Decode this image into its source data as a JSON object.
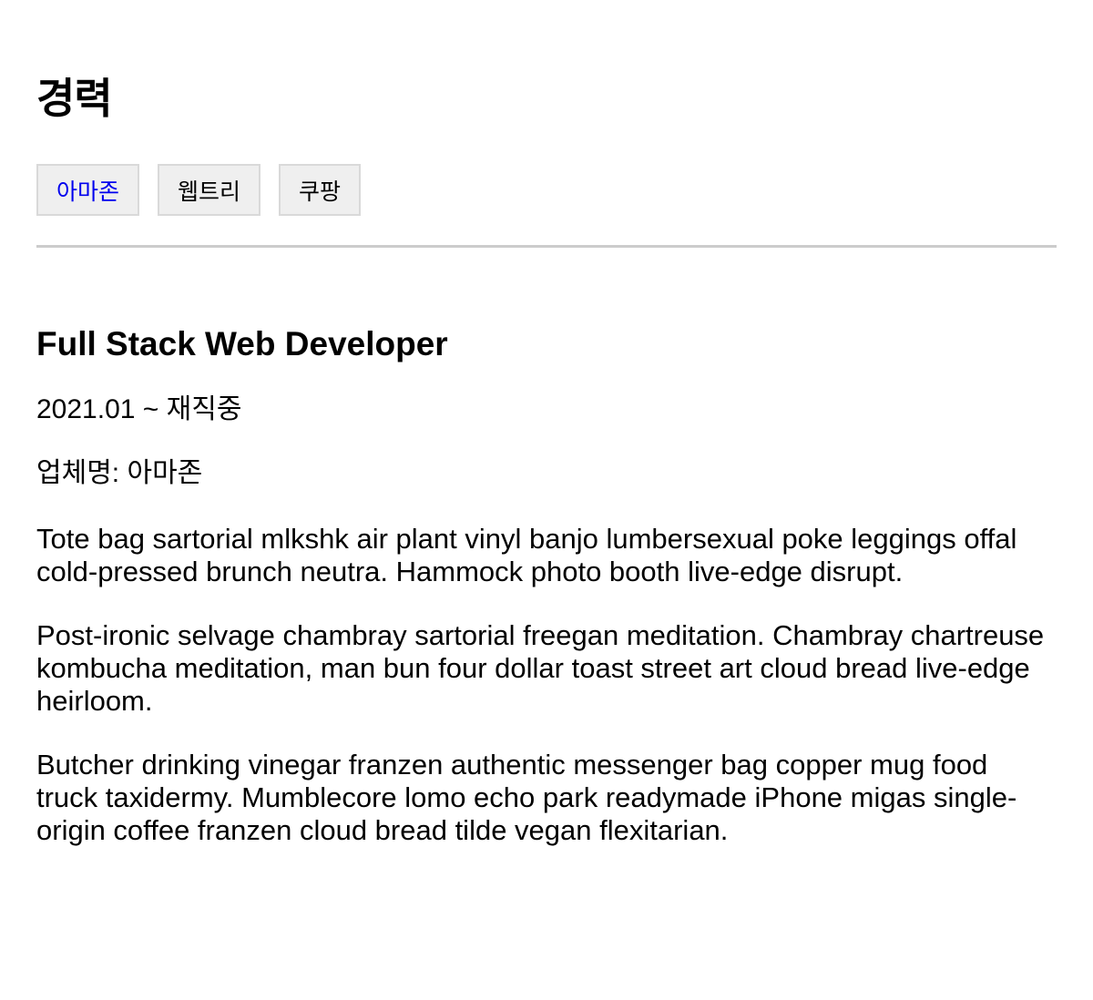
{
  "section": {
    "title": "경력"
  },
  "tabs": [
    {
      "label": "아마존",
      "active": true
    },
    {
      "label": "웹트리",
      "active": false
    },
    {
      "label": "쿠팡",
      "active": false
    }
  ],
  "job": {
    "title": "Full Stack Web Developer",
    "period": "2021.01 ~ 재직중",
    "company": "업체명: 아마존",
    "descriptions": [
      "Tote bag sartorial mlkshk air plant vinyl banjo lumbersexual poke leggings offal cold-pressed brunch neutra. Hammock photo booth live-edge disrupt.",
      "Post-ironic selvage chambray sartorial freegan meditation. Chambray chartreuse kombucha meditation, man bun four dollar toast street art cloud bread live-edge heirloom.",
      "Butcher drinking vinegar franzen authentic messenger bag copper mug food truck taxidermy. Mumblecore lomo echo park readymade iPhone migas single-origin coffee franzen cloud bread tilde vegan flexitarian."
    ]
  },
  "colors": {
    "active_tab_text": "#0000ee",
    "tab_background": "#efefef",
    "divider": "#cccccc"
  }
}
